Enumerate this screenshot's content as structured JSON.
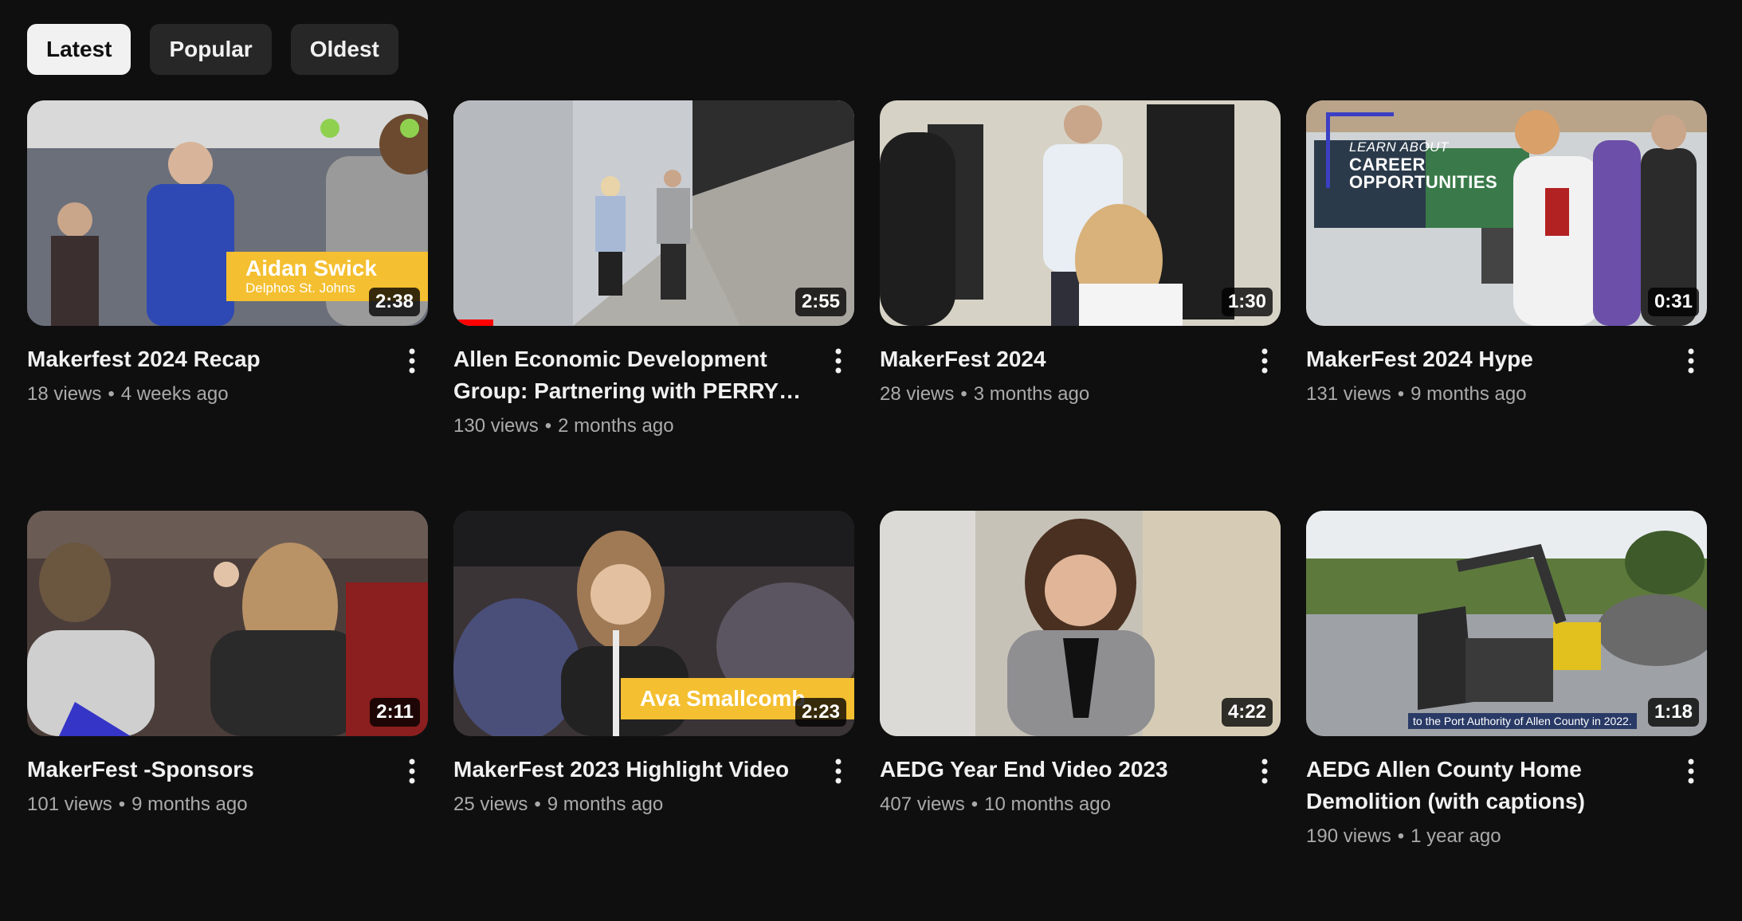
{
  "filters": [
    {
      "label": "Latest",
      "active": true
    },
    {
      "label": "Popular",
      "active": false
    },
    {
      "label": "Oldest",
      "active": false
    }
  ],
  "videos": [
    {
      "title": "Makerfest 2024 Recap",
      "views": "18 views",
      "age": "4 weeks ago",
      "duration": "2:38",
      "overlay": {
        "name": "Aidan Swick",
        "sub": "Delphos St. Johns"
      }
    },
    {
      "title": "Allen Economic Development Group: Partnering with PERRY…",
      "views": "130 views",
      "age": "2 months ago",
      "duration": "2:55",
      "watched_fraction": 0.1
    },
    {
      "title": "MakerFest 2024",
      "views": "28 views",
      "age": "3 months ago",
      "duration": "1:30"
    },
    {
      "title": "MakerFest 2024 Hype",
      "views": "131 views",
      "age": "9 months ago",
      "duration": "0:31",
      "overlay_text": {
        "top": "LEARN ABOUT",
        "main": "CAREER OPPORTUNITIES"
      }
    },
    {
      "title": "MakerFest -Sponsors",
      "views": "101 views",
      "age": "9 months ago",
      "duration": "2:11"
    },
    {
      "title": "MakerFest 2023 Highlight Video",
      "views": "25 views",
      "age": "9 months ago",
      "duration": "2:23",
      "overlay": {
        "name": "Ava Smallcomb",
        "sub": ""
      }
    },
    {
      "title": "AEDG Year End Video 2023",
      "views": "407 views",
      "age": "10 months ago",
      "duration": "4:22"
    },
    {
      "title": "AEDG Allen County Home Demolition (with captions)",
      "views": "190 views",
      "age": "1 year ago",
      "duration": "1:18",
      "subtitle": "to the Port Authority of Allen County in 2022."
    }
  ],
  "colors": {
    "background": "#0f0f0f",
    "chip": "#272727",
    "chip_active": "#f1f1f1",
    "meta": "#aaaaaa",
    "accent_yellow": "#f4bf30",
    "progress": "#ff0000"
  }
}
